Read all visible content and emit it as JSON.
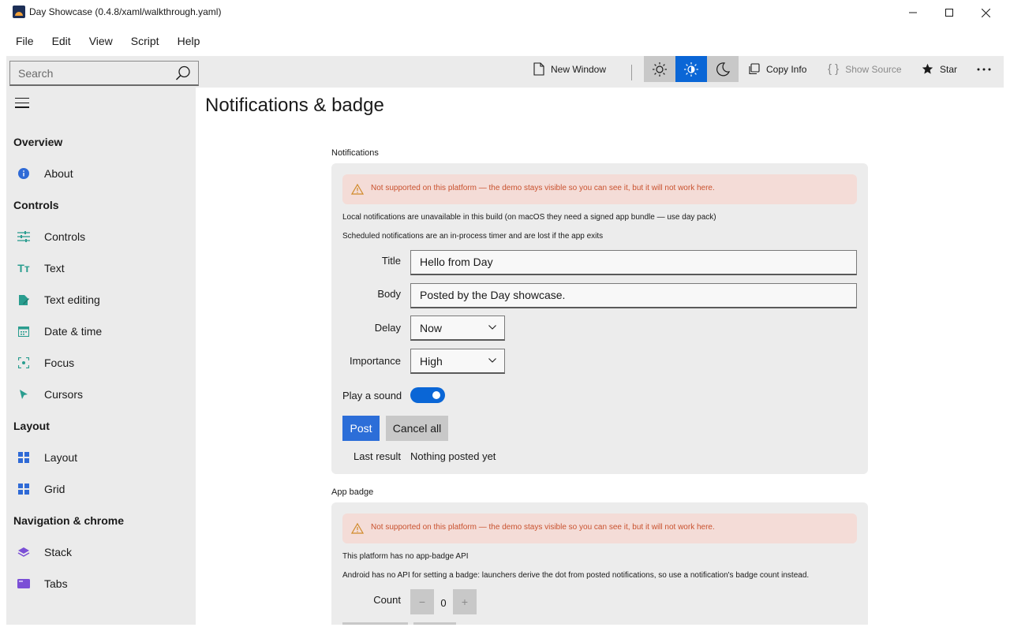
{
  "window": {
    "title": "Day Showcase (0.4.8/xaml/walkthrough.yaml)"
  },
  "menu": [
    "File",
    "Edit",
    "View",
    "Script",
    "Help"
  ],
  "search": {
    "placeholder": "Search"
  },
  "toolbar": {
    "new_window": "New Window",
    "copy_info": "Copy Info",
    "show_source": "Show Source",
    "star": "Star",
    "theme_selected": "system",
    "accent_color": "#0a66d6"
  },
  "sidebar": {
    "sections": [
      {
        "header": "Overview",
        "items": [
          {
            "label": "About",
            "icon": "info-icon"
          }
        ]
      },
      {
        "header": "Controls",
        "items": [
          {
            "label": "Controls",
            "icon": "sliders-icon"
          },
          {
            "label": "Text",
            "icon": "text-size-icon"
          },
          {
            "label": "Text editing",
            "icon": "pen-edit-icon"
          },
          {
            "label": "Date & time",
            "icon": "calendar-icon"
          },
          {
            "label": "Focus",
            "icon": "focus-icon"
          },
          {
            "label": "Cursors",
            "icon": "cursor-icon"
          }
        ]
      },
      {
        "header": "Layout",
        "items": [
          {
            "label": "Layout",
            "icon": "layout-grid-icon"
          },
          {
            "label": "Grid",
            "icon": "grid-icon"
          }
        ]
      },
      {
        "header": "Navigation & chrome",
        "items": [
          {
            "label": "Stack",
            "icon": "stack-layers-icon"
          },
          {
            "label": "Tabs",
            "icon": "tabs-icon"
          }
        ]
      }
    ]
  },
  "page": {
    "title": "Notifications & badge"
  },
  "notifications": {
    "section_label": "Notifications",
    "warning": "Not supported on this platform — the demo stays visible so you can see it, but it will not work here.",
    "info1": "Local notifications are unavailable in this build (on macOS they need a signed app bundle — use day pack)",
    "info2": "Scheduled notifications are an in-process timer and are lost if the app exits",
    "title_label": "Title",
    "title_value": "Hello from Day",
    "body_label": "Body",
    "body_value": "Posted by the Day showcase.",
    "delay_label": "Delay",
    "delay_value": "Now",
    "importance_label": "Importance",
    "importance_value": "High",
    "sound_label": "Play a sound",
    "sound_on": true,
    "post_button": "Post",
    "cancel_button": "Cancel all",
    "last_result_label": "Last result",
    "last_result_value": "Nothing posted yet"
  },
  "badge": {
    "section_label": "App badge",
    "warning": "Not supported on this platform — the demo stays visible so you can see it, but it will not work here.",
    "info1": "This platform has no app-badge API",
    "info2": "Android has no API for setting a badge: launchers derive the dot from posted notifications, so use a notification's badge count instead.",
    "count_label": "Count",
    "count_value": "0",
    "minus": "−",
    "plus": "+"
  }
}
